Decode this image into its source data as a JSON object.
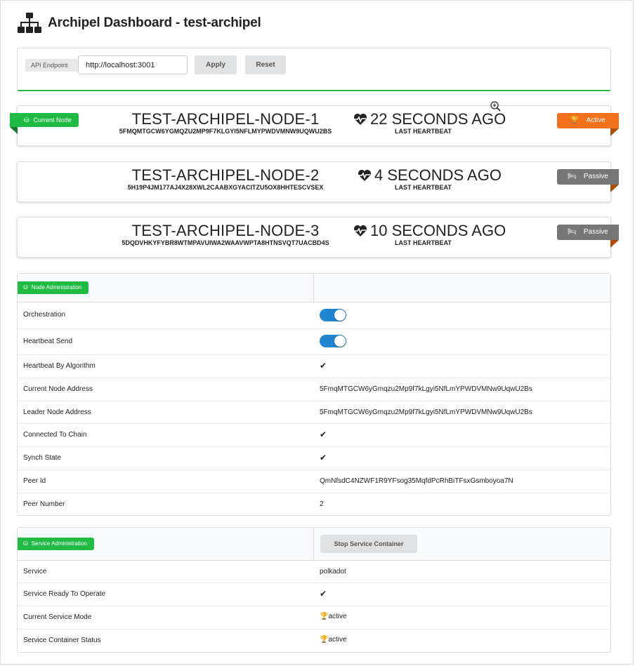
{
  "header": {
    "title": "Archipel Dashboard - test-archipel",
    "icon": "sitemap-icon"
  },
  "api": {
    "label": "API Endpoint",
    "value": "http://localhost:3001",
    "apply_label": "Apply",
    "reset_label": "Reset"
  },
  "nodes": [
    {
      "name": "TEST-ARCHIPEL-NODE-1",
      "address": "5FMQMTGCW6YGMQZU2MP9F7KLGYI5NFLMYPWDVMNW9UQWU2BS",
      "heartbeat": "22 SECONDS AGO",
      "heartbeat_label": "LAST HEARTBEAT",
      "badge": "Active",
      "current_label": "Current Node"
    },
    {
      "name": "TEST-ARCHIPEL-NODE-2",
      "address": "5H19P4JM177AJ4X28XWL2CAABXGYACITZU5OX8HHTESCVSEX",
      "heartbeat": "4 SECONDS AGO",
      "heartbeat_label": "LAST HEARTBEAT",
      "badge": "Passive"
    },
    {
      "name": "TEST-ARCHIPEL-NODE-3",
      "address": "5DQDVHKYFYBR8WTMPAVUIWA2WAAVWPTA8HTNSVQT7UACBD4S",
      "heartbeat": "10 SECONDS AGO",
      "heartbeat_label": "LAST HEARTBEAT",
      "badge": "Passive"
    }
  ],
  "node_admin": {
    "title": "Node Administration",
    "rows": [
      {
        "label": "Orchestration",
        "value": ""
      },
      {
        "label": "Heartbeat Send",
        "value": ""
      },
      {
        "label": "Heartbeat By Algorithm",
        "value": "✔"
      },
      {
        "label": "Current Node Address",
        "value": "5FmqMTGCW6yGmqzu2Mp9f7kLgyi5NfLmYPWDVMNw9UqwU2Bs"
      },
      {
        "label": "Leader Node Address",
        "value": "5FmqMTGCW6yGmqzu2Mp9f7kLgyi5NfLmYPWDVMNw9UqwU2Bs"
      },
      {
        "label": "Connected To Chain",
        "value": "✔"
      },
      {
        "label": "Synch State",
        "value": "✔"
      },
      {
        "label": "Peer Id",
        "value": "QmNfsdC4NZWF1R9YFsog35MqfdPcRhBiTFsxGsmboyoa7N"
      },
      {
        "label": "Peer Number",
        "value": "2"
      }
    ]
  },
  "service_admin": {
    "title": "Service Administration",
    "stop_label": "Stop Service Container",
    "rows": [
      {
        "label": "Service",
        "value": "polkadot"
      },
      {
        "label": "Service Ready To Operate",
        "value": "✔"
      },
      {
        "label": "Current Service Mode",
        "value": "active"
      },
      {
        "label": "Service Container Status",
        "value": "active"
      }
    ]
  },
  "colors": {
    "green": "#21ba45",
    "orange": "#f2711c",
    "grey": "#767676",
    "blue": "#2185d0"
  }
}
